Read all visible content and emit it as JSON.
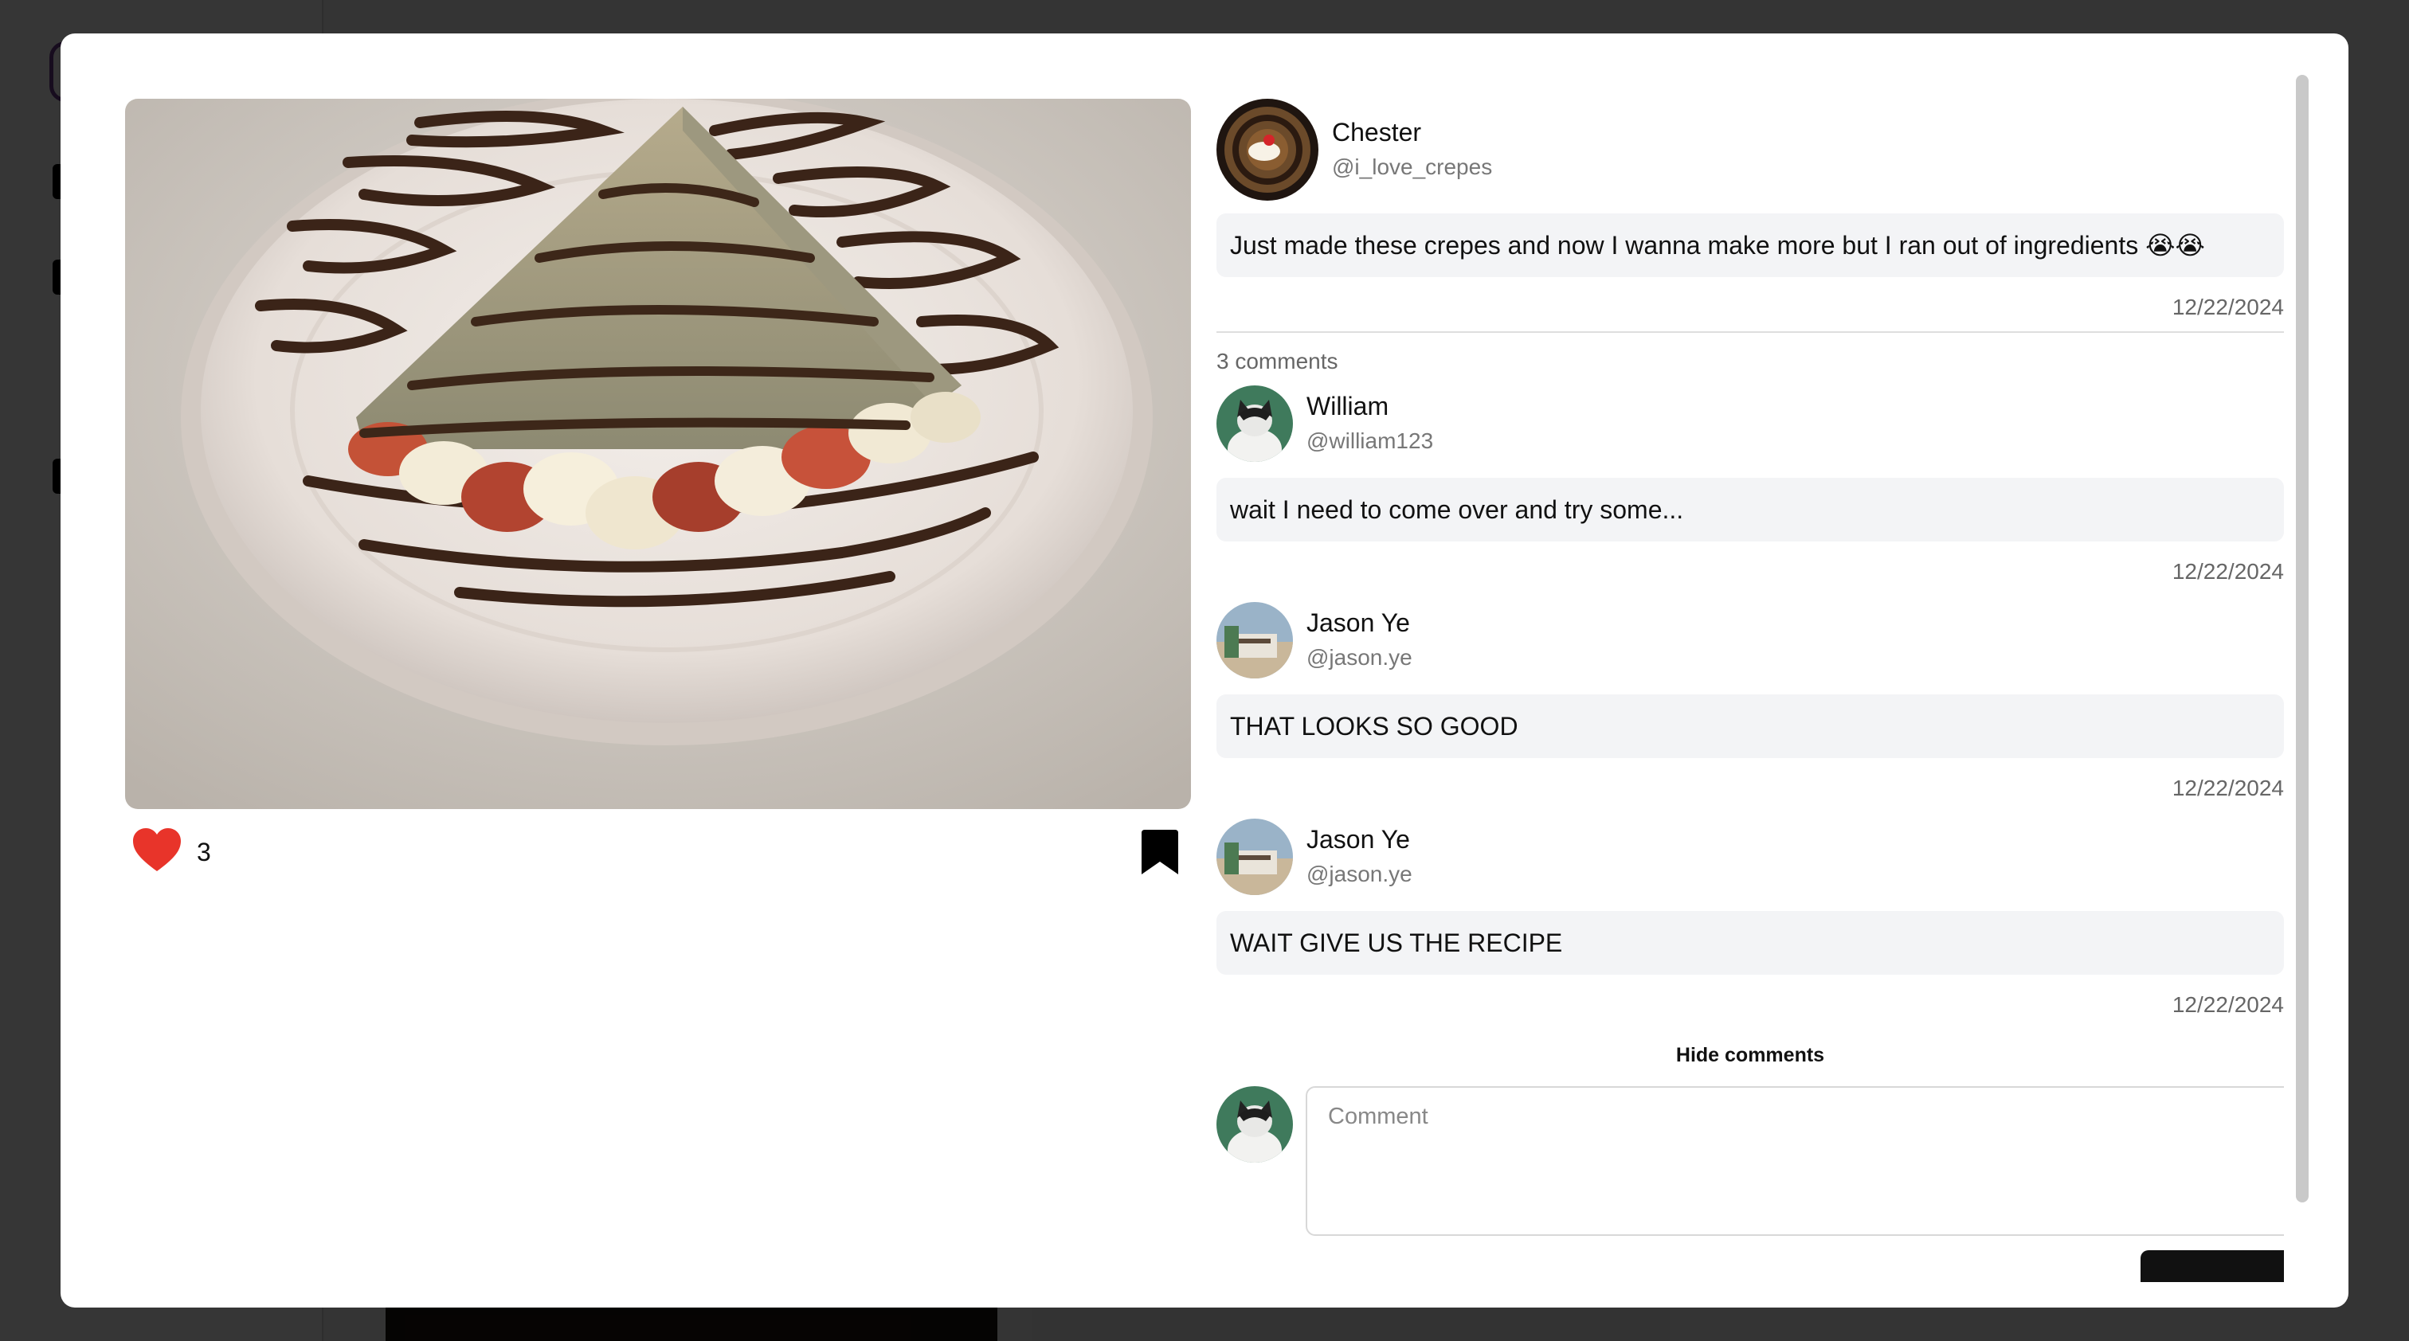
{
  "post": {
    "likes": "3",
    "author": {
      "name": "Chester",
      "handle": "@i_love_crepes"
    },
    "text": "Just made these crepes and now I wanna make more but I ran out of ingredients 😭😭",
    "date": "12/22/2024"
  },
  "comments_section": {
    "count_label": "3 comments",
    "hide_label": "Hide comments",
    "comments": [
      {
        "name": "William",
        "handle": "@william123",
        "text": "wait I need to come over and try some...",
        "date": "12/22/2024"
      },
      {
        "name": "Jason Ye",
        "handle": "@jason.ye",
        "text": "THAT LOOKS SO GOOD",
        "date": "12/22/2024"
      },
      {
        "name": "Jason Ye",
        "handle": "@jason.ye",
        "text": "WAIT GIVE US THE RECIPE",
        "date": "12/22/2024"
      }
    ]
  },
  "compose": {
    "placeholder": "Comment"
  },
  "colors": {
    "like": "#e8342a",
    "bubble": "#f3f4f6",
    "muted_text": "#777777"
  },
  "icons": {
    "like": "heart-icon",
    "save": "bookmark-icon"
  }
}
